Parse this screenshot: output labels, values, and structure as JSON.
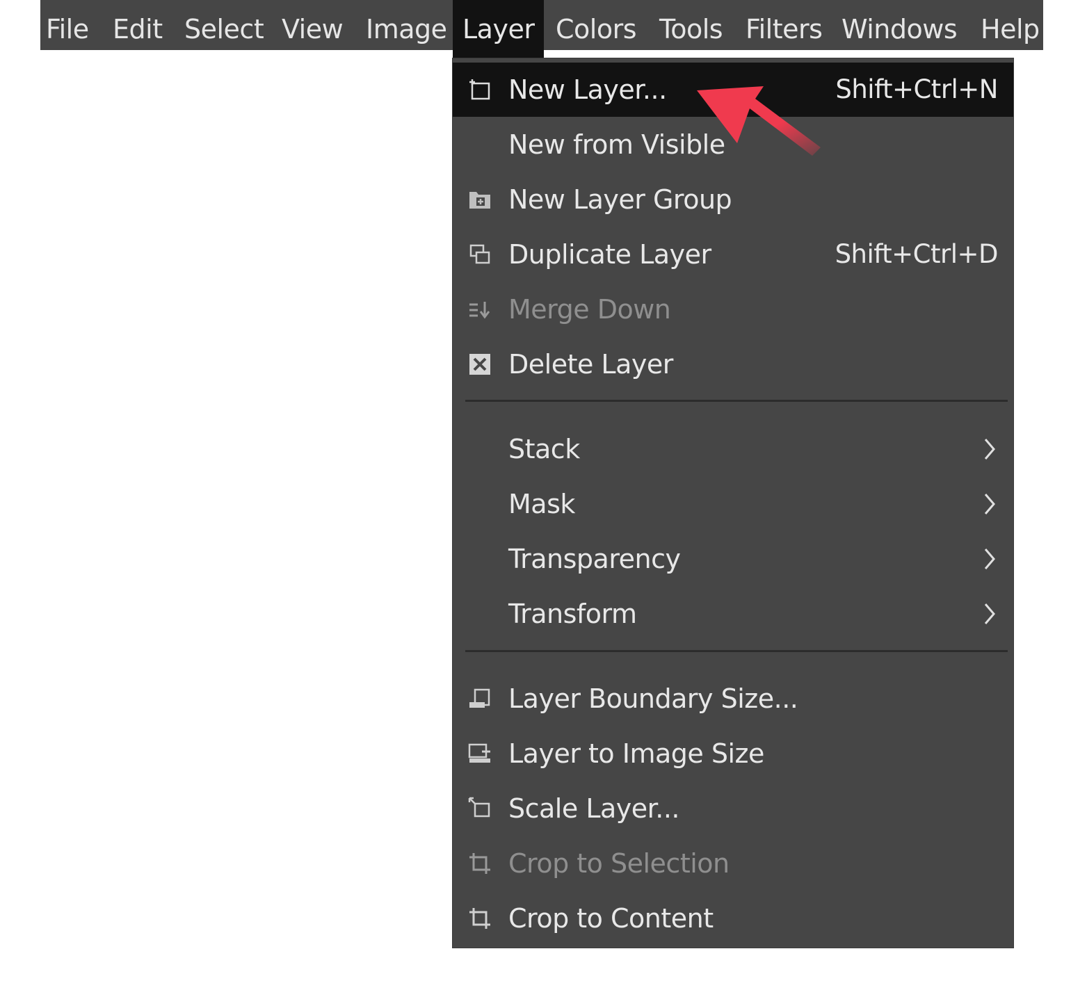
{
  "menubar": {
    "items": [
      {
        "label": "File"
      },
      {
        "label": "Edit"
      },
      {
        "label": "Select"
      },
      {
        "label": "View"
      },
      {
        "label": "Image"
      },
      {
        "label": "Layer"
      },
      {
        "label": "Colors"
      },
      {
        "label": "Tools"
      },
      {
        "label": "Filters"
      },
      {
        "label": "Windows"
      },
      {
        "label": "Help"
      }
    ],
    "active": "Layer"
  },
  "layer_menu": {
    "items": [
      {
        "label": "New Layer...",
        "shortcut": "Shift+Ctrl+N",
        "icon": "new-layer-icon",
        "highlighted": true
      },
      {
        "label": "New from Visible",
        "shortcut": "",
        "icon": ""
      },
      {
        "label": "New Layer Group",
        "shortcut": "",
        "icon": "new-layer-group-icon"
      },
      {
        "label": "Duplicate Layer",
        "shortcut": "Shift+Ctrl+D",
        "icon": "duplicate-layer-icon"
      },
      {
        "label": "Merge Down",
        "shortcut": "",
        "icon": "merge-down-icon",
        "disabled": true
      },
      {
        "label": "Delete Layer",
        "shortcut": "",
        "icon": "delete-layer-icon"
      },
      {
        "label": "Stack",
        "submenu": true
      },
      {
        "label": "Mask",
        "submenu": true
      },
      {
        "label": "Transparency",
        "submenu": true
      },
      {
        "label": "Transform",
        "submenu": true
      },
      {
        "label": "Layer Boundary Size...",
        "icon": "layer-boundary-size-icon"
      },
      {
        "label": "Layer to Image Size",
        "icon": "layer-to-image-size-icon"
      },
      {
        "label": "Scale Layer...",
        "icon": "scale-layer-icon"
      },
      {
        "label": "Crop to Selection",
        "icon": "crop-icon",
        "disabled": true
      },
      {
        "label": "Crop to Content",
        "icon": "crop-icon"
      }
    ]
  },
  "colors": {
    "menubar_bg": "#464646",
    "menu_bg": "#464646",
    "highlight_bg": "#121212",
    "text": "#e8e8e8",
    "disabled_text": "#8f8f8f",
    "pointer_arrow": "#f03a4e"
  }
}
